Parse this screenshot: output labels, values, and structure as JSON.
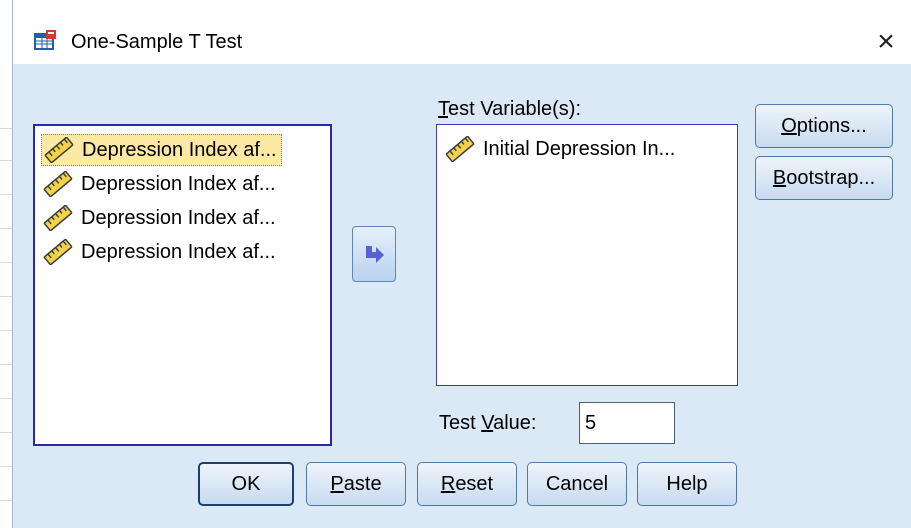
{
  "window": {
    "title": "One-Sample T Test",
    "close_glyph": "×"
  },
  "source_variables": {
    "items": [
      {
        "label": "Depression Index af...",
        "icon": "ruler-icon",
        "selected": true
      },
      {
        "label": "Depression Index af...",
        "icon": "ruler-icon",
        "selected": false
      },
      {
        "label": "Depression Index af...",
        "icon": "ruler-icon",
        "selected": false
      },
      {
        "label": "Depression Index af...",
        "icon": "ruler-icon",
        "selected": false
      }
    ]
  },
  "move_button": {
    "icon": "arrow-right-icon"
  },
  "test_variables": {
    "label_first": "T",
    "label_rest": "est Variable(s):",
    "items": [
      {
        "label": "Initial Depression In...",
        "icon": "ruler-icon"
      }
    ]
  },
  "side_buttons": {
    "options_first": "O",
    "options_rest": "ptions...",
    "bootstrap_first": "B",
    "bootstrap_rest": "ootstrap..."
  },
  "test_value": {
    "label_pre": "Test ",
    "label_u": "V",
    "label_post": "alue:",
    "value": "5"
  },
  "bottom_buttons": {
    "ok": "OK",
    "paste_first": "P",
    "paste_rest": "aste",
    "reset_first": "R",
    "reset_rest": "eset",
    "cancel": "Cancel",
    "help": "Help"
  },
  "colors": {
    "dialog_bg": "#dbe8f6",
    "selection": "#fde9a3",
    "listbox_border": "#2a2aa8",
    "arrow_accent": "#5a5fd4"
  }
}
